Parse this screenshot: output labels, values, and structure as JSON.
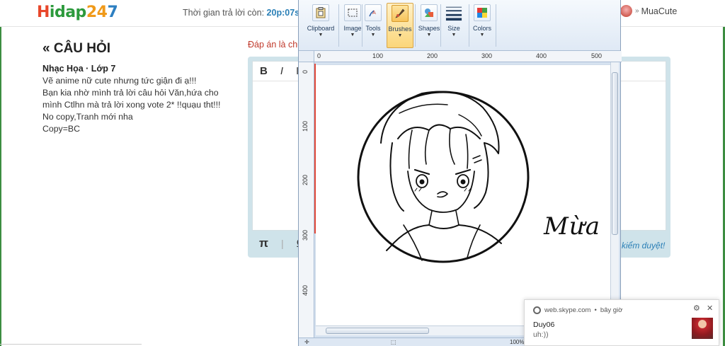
{
  "site": {
    "logo_parts": [
      "H",
      "idap",
      "24",
      "7"
    ],
    "timer_label": "Thời gian trả lời còn:",
    "timer_value": "20p:07s",
    "username": "MuaCute"
  },
  "question": {
    "title": "CÂU HỎI",
    "meta": "Nhạc Họa · Lớp 7",
    "lines": [
      "Vẽ anime nữ cute nhưng tức giận đi ạ!!!",
      "Bạn kia nhờ mình trả lời câu hỏi Văn,hứa cho mình Ctlhn mà trả lời xong vote 2* !!quạu tht!!!",
      "No copy,Tranh mới nha",
      "Copy=BC"
    ]
  },
  "answer": {
    "hint": "Đáp án là chu",
    "toolbar": [
      "B",
      "I",
      "I"
    ],
    "bottom_symbols": [
      "π",
      "|",
      "Ω"
    ],
    "review_note": "kiểm duyệt!"
  },
  "paint": {
    "ribbon": [
      {
        "label": "Clipboard"
      },
      {
        "label": "Image"
      },
      {
        "label": "Tools"
      },
      {
        "label": "Brushes",
        "active": true
      },
      {
        "label": "Shapes"
      },
      {
        "label": "Size"
      },
      {
        "label": "Colors"
      }
    ],
    "ruler_top": [
      "0",
      "100",
      "200",
      "300",
      "400",
      "500"
    ],
    "ruler_left": [
      "0",
      "100",
      "200",
      "300",
      "400"
    ],
    "signature": "Mừa",
    "status_zoom": "100%"
  },
  "toast": {
    "source": "web.skype.com",
    "time": "bây giờ",
    "sender": "Duy06",
    "message": "uh:))"
  },
  "colors": {
    "accent_blue": "#2a7fb6",
    "hint_red": "#c0392b",
    "paint_frame": "#d6e2f0",
    "edge_green": "#3c8d40"
  }
}
